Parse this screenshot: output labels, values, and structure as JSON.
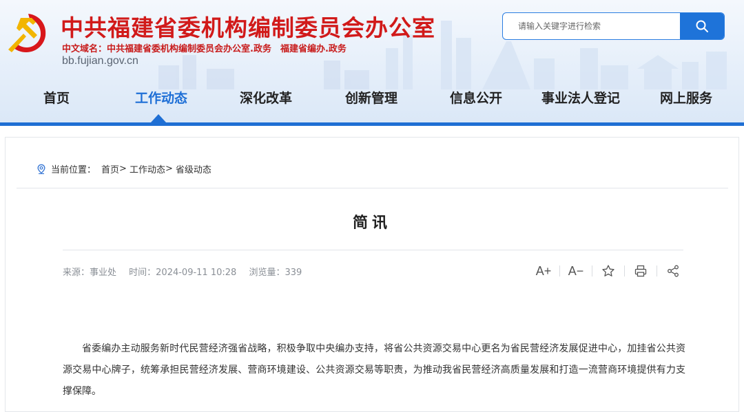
{
  "header": {
    "title": "中共福建省委机构编制委员会办公室",
    "subtitle": "中文域名：中共福建省委机构编制委员会办公室.政务　福建省编办.政务",
    "domain": "bb.fujian.gov.cn",
    "emblem_icon": "party-emblem-icon",
    "title_color": "#d11a1a"
  },
  "search": {
    "placeholder": "请输入关键字进行检索",
    "button_icon": "search-icon",
    "accent_color": "#1e73d9"
  },
  "nav": {
    "items": [
      {
        "label": "首页"
      },
      {
        "label": "工作动态"
      },
      {
        "label": "深化改革"
      },
      {
        "label": "创新管理"
      },
      {
        "label": "信息公开"
      },
      {
        "label": "事业法人登记"
      },
      {
        "label": "网上服务"
      }
    ],
    "active": "工作动态"
  },
  "breadcrumb": {
    "prefix": "当前位置：",
    "items": [
      "首页",
      "工作动态",
      "省级动态"
    ],
    "separator": ">"
  },
  "article": {
    "title": "简讯",
    "source": "来源：事业处",
    "time": "时间：2024-09-11 10:28",
    "views": "浏览量：339",
    "body": "省委编办主动服务新时代民营经济强省战略，积极争取中央编办支持，将省公共资源交易中心更名为省民营经济发展促进中心，加挂省公共资源交易中心牌子，统筹承担民营经济发展、营商环境建设、公共资源交易等职责，为推动我省民营经济高质量发展和打造一流营商环境提供有力支撑保障。"
  },
  "tools": {
    "font_increase": "A+",
    "font_decrease": "A−",
    "icons": [
      "font-increase-icon",
      "font-decrease-icon",
      "star-icon",
      "print-icon",
      "share-icon"
    ]
  }
}
